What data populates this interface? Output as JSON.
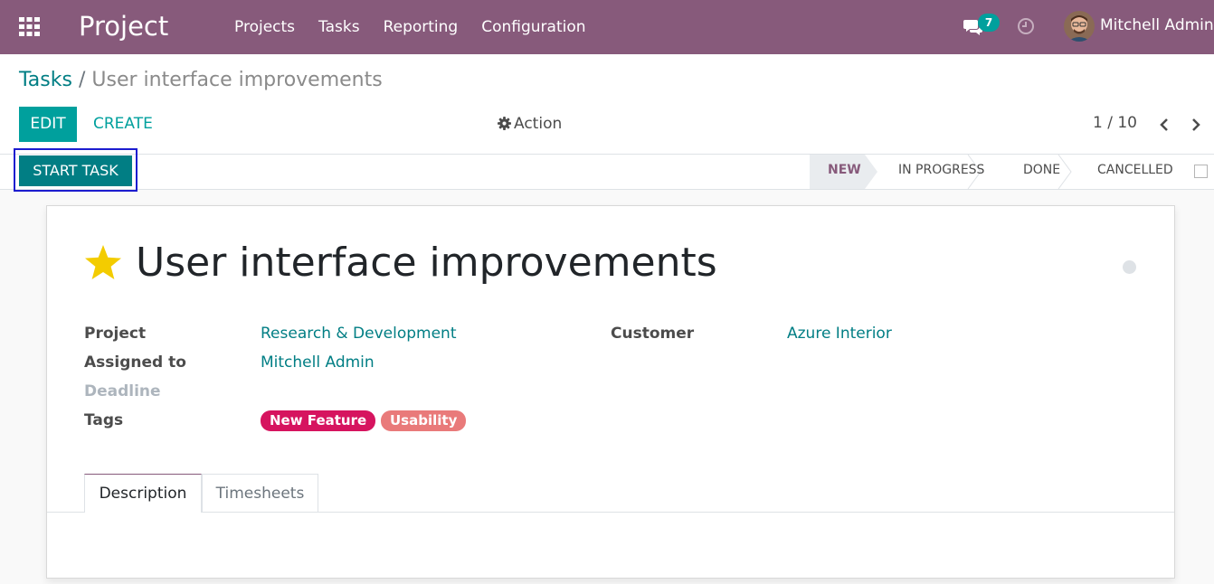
{
  "navbar": {
    "app_title": "Project",
    "menu": [
      "Projects",
      "Tasks",
      "Reporting",
      "Configuration"
    ],
    "messages_count": "7",
    "user_name": "Mitchell Admin",
    "icons": [
      "apps-grid-icon",
      "chat-icon",
      "clock-icon"
    ],
    "color": "#875a7b"
  },
  "breadcrumb": {
    "parent": "Tasks",
    "separator": "/",
    "current": "User interface improvements"
  },
  "buttons": {
    "edit": "EDIT",
    "create": "CREATE",
    "action": "Action",
    "start_task": "START TASK"
  },
  "pager": {
    "value": "1 / 10"
  },
  "stages": [
    {
      "label": "NEW",
      "active": true
    },
    {
      "label": "IN PROGRESS",
      "active": false
    },
    {
      "label": "DONE",
      "active": false
    },
    {
      "label": "CANCELLED",
      "active": false
    }
  ],
  "task": {
    "title": "User interface improvements",
    "starred": true,
    "fields": {
      "project": {
        "label": "Project",
        "value": "Research & Development"
      },
      "assigned_to": {
        "label": "Assigned to",
        "value": "Mitchell Admin"
      },
      "deadline": {
        "label": "Deadline",
        "value": ""
      },
      "tags": {
        "label": "Tags",
        "values": [
          "New Feature",
          "Usability"
        ]
      },
      "customer": {
        "label": "Customer",
        "value": "Azure Interior"
      }
    },
    "tag_colors": [
      "#d6145f",
      "#e97a7a"
    ]
  },
  "tabs": [
    "Description",
    "Timesheets"
  ],
  "colors": {
    "accent": "#00a09d",
    "primary_dark": "#017e84",
    "link": "#017e84",
    "star": "#f3cc00"
  }
}
